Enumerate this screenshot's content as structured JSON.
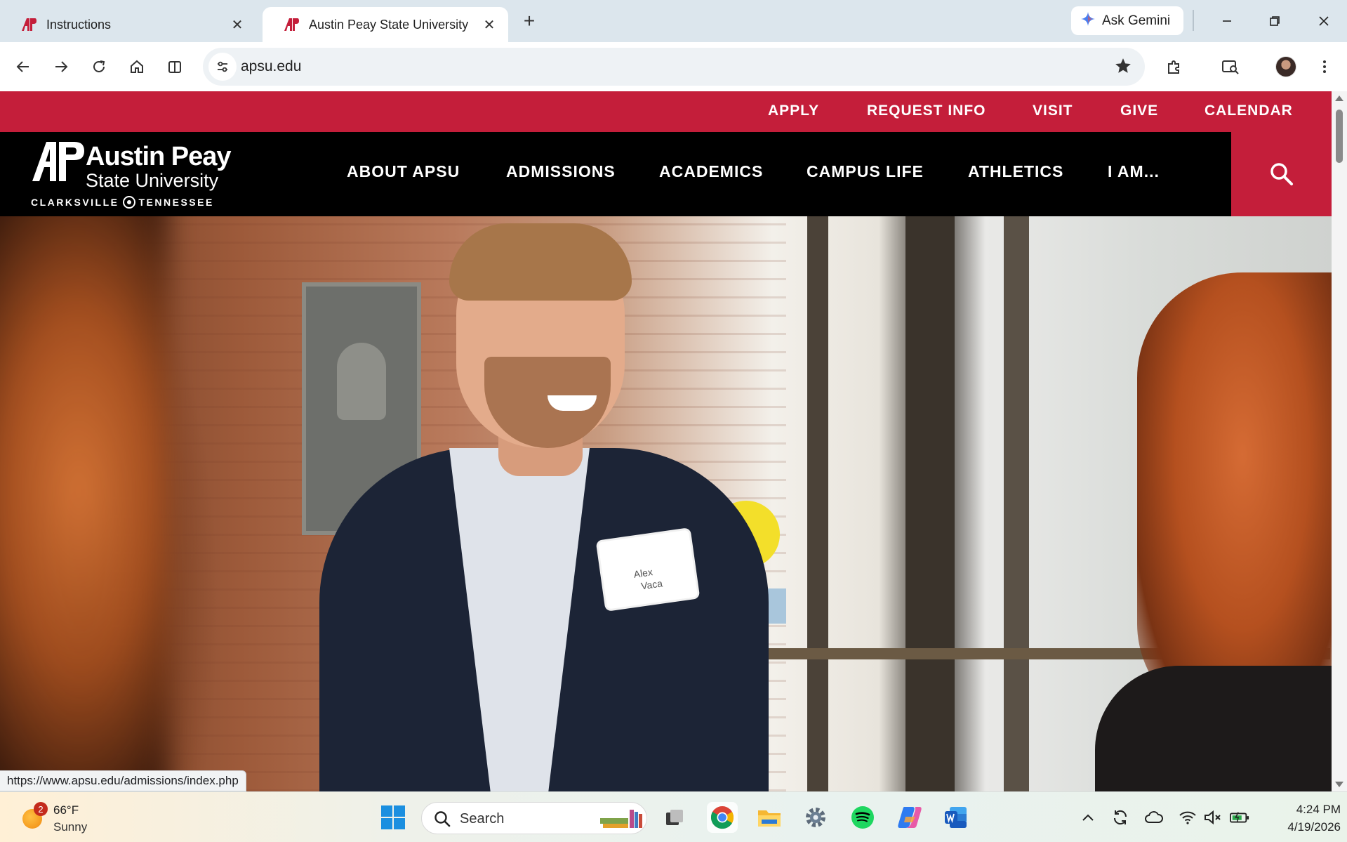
{
  "browser": {
    "tabs": [
      {
        "title": "Instructions",
        "active": false
      },
      {
        "title": "Austin Peay State University",
        "active": true
      }
    ],
    "gemini_label": "Ask Gemini",
    "url": "apsu.edu",
    "status_url": "https://www.apsu.edu/admissions/index.php"
  },
  "site": {
    "utility_links": [
      "APPLY",
      "REQUEST INFO",
      "VISIT",
      "GIVE",
      "CALENDAR"
    ],
    "logo": {
      "line1": "Austin Peay",
      "line2": "State University",
      "place_left": "CLARKSVILLE",
      "place_right": "TENNESSEE"
    },
    "nav_links": [
      "ABOUT APSU",
      "ADMISSIONS",
      "ACADEMICS",
      "CAMPUS LIFE",
      "ATHLETICS",
      "I AM..."
    ],
    "hero_badge_name": [
      "Alex",
      "Vaca"
    ],
    "colors": {
      "brand_red": "#c41e3a",
      "nav_black": "#000000"
    }
  },
  "taskbar": {
    "weather": {
      "temp": "66°F",
      "condition": "Sunny",
      "notification_count": "2"
    },
    "search_placeholder": "Search",
    "apps": [
      "task-view-icon",
      "chrome-icon",
      "file-explorer-icon",
      "settings-icon",
      "spotify-icon",
      "copilot-icon",
      "word-icon"
    ],
    "clock": {
      "time": "4:24 PM",
      "date": "4/19/2026"
    }
  }
}
